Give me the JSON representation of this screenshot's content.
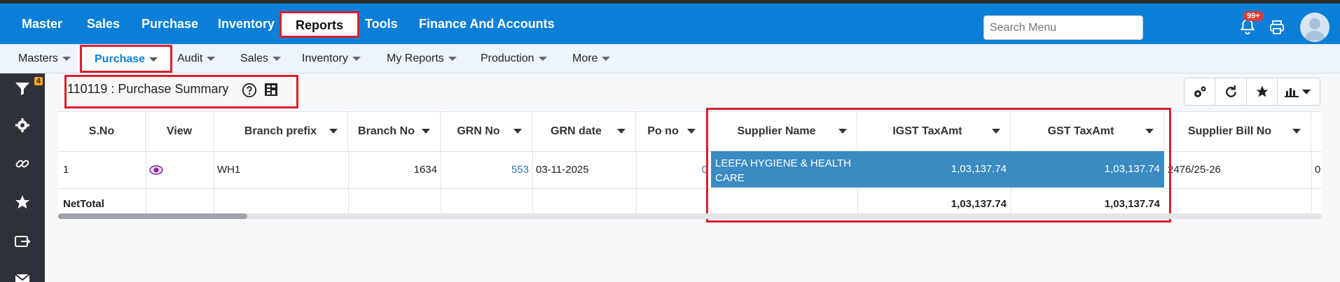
{
  "topnav": {
    "items": [
      "Master",
      "Sales",
      "Purchase",
      "Inventory",
      "Reports",
      "Tools",
      "Finance And Accounts"
    ],
    "active": "Reports",
    "search_placeholder": "Search Menu",
    "notification_count": "99+"
  },
  "subnav": {
    "items": [
      "Masters",
      "Purchase",
      "Audit",
      "Sales",
      "Inventory",
      "My Reports",
      "Production",
      "More"
    ],
    "active": "Purchase"
  },
  "sidebar": {
    "filter_badge": "4",
    "icons": [
      "filter-icon",
      "gear-icon",
      "link-icon",
      "star-icon",
      "export-icon",
      "mail-icon"
    ]
  },
  "report": {
    "title": "110119 : Purchase Summary"
  },
  "table": {
    "headers": [
      "S.No",
      "View",
      "Branch prefix",
      "Branch No",
      "GRN No",
      "GRN date",
      "Po no",
      "Supplier Name",
      "IGST TaxAmt",
      "GST TaxAmt",
      "Supplier Bill No"
    ],
    "rows": [
      {
        "sno": "1",
        "branch_prefix": "WH1",
        "branch_no": "1634",
        "grn_no": "553",
        "grn_date": "03-11-2025",
        "po_no": "0",
        "supplier_name": "LEEFA HYGIENE & HEALTH CARE",
        "igst": "1,03,137.74",
        "gst": "1,03,137.74",
        "supplier_bill_no": "2476/25-26",
        "extra": "0"
      }
    ],
    "footer": {
      "label": "NetTotal",
      "igst": "1,03,137.74",
      "gst": "1,03,137.74"
    }
  },
  "colors": {
    "nav_blue": "#0a7fd8",
    "highlight_red": "#d9202f",
    "selected_cell": "#3a8bc2",
    "sidebar_dark": "#2e3138"
  }
}
